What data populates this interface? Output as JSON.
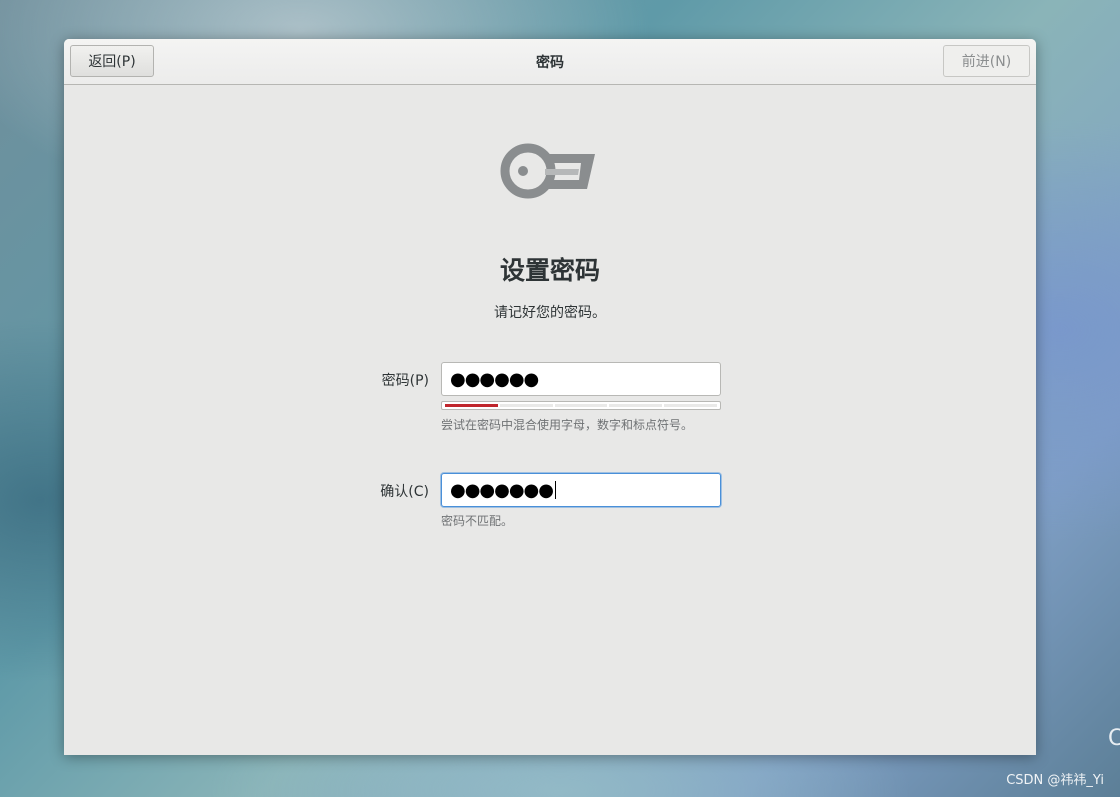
{
  "window": {
    "back_label": "返回(P)",
    "title": "密码",
    "next_label": "前进(N)"
  },
  "page": {
    "icon": "key-icon",
    "heading": "设置密码",
    "subtitle": "请记好您的密码。"
  },
  "password": {
    "label": "密码(P)",
    "value_masked": "●●●●●●",
    "strength_fraction": 0.2,
    "strength_color": "#c0262d",
    "hint": "尝试在密码中混合使用字母，数字和标点符号。"
  },
  "confirm": {
    "label": "确认(C)",
    "value_masked": "●●●●●●●",
    "hint": "密码不匹配。"
  },
  "desktop": {
    "watermark": "CSDN @祎祎_Yi"
  }
}
